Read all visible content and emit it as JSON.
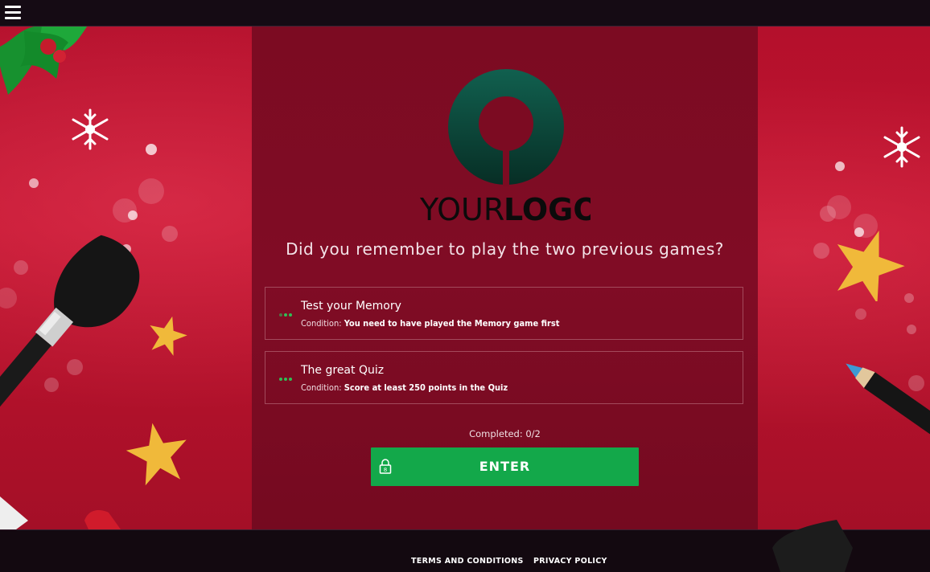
{
  "header": {
    "menu_icon": "hamburger-menu-icon"
  },
  "logo": {
    "text_light": "YOUR",
    "text_bold": "LOGO",
    "accent": "#0d4a3e"
  },
  "main": {
    "question": "Did you remember to play the two previous games?",
    "games": [
      {
        "title": "Test your Memory",
        "condition_label": "Condition:",
        "condition_value": "You need to have played the Memory game first"
      },
      {
        "title": "The great Quiz",
        "condition_label": "Condition:",
        "condition_value": "Score at least 250 points in the Quiz"
      }
    ],
    "completed": "Completed: 0/2",
    "enter_label": "ENTER",
    "lock_icon": "lock-icon"
  },
  "footer": {
    "terms": "TERMS AND CONDITIONS",
    "privacy": "PRIVACY POLICY"
  },
  "colors": {
    "background_red": "#c0142f",
    "panel": "#7c0b22",
    "button_green": "#13a84a",
    "dots_green": "#2fbf55",
    "star_gold": "#f0b93a"
  }
}
